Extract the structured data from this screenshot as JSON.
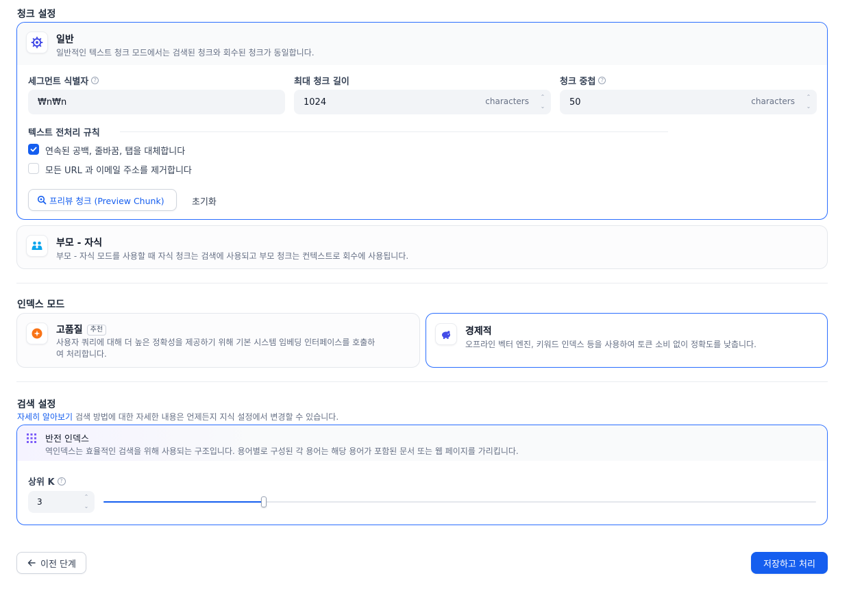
{
  "chunk_settings": {
    "title": "청크 설정",
    "general": {
      "icon": "gear-icon",
      "title": "일반",
      "desc": "일반적인 텍스트 청크 모드에서는 검색된 청크와 회수된 청크가 동일합니다.",
      "segment_label": "세그먼트 식별자",
      "segment_value": "₩n₩n",
      "max_length_label": "최대 청크 길이",
      "max_length_value": "1024",
      "overlap_label": "청크 중첩",
      "overlap_value": "50",
      "unit": "characters",
      "preprocess_label": "텍스트 전처리 규칙",
      "rule1": "연속된 공백, 줄바꿈, 탭을 대체합니다",
      "rule1_checked": true,
      "rule2": "모든 URL 과 이메일 주소를 제거합니다",
      "rule2_checked": false,
      "preview_button": "프리뷰 청크 (Preview Chunk)",
      "reset_button": "초기화"
    },
    "parent_child": {
      "icon": "parent-child-icon",
      "title": "부모 - 자식",
      "desc": "부모 - 자식 모드를 사용할 때 자식 청크는 검색에 사용되고 부모 청크는 컨텍스트로 회수에 사용됩니다."
    }
  },
  "index_mode": {
    "title": "인덱스 모드",
    "high_quality": {
      "icon": "sparkle-icon",
      "title": "고품질",
      "badge": "추천",
      "desc_line1": "사용자 쿼리에 대해 더 높은 정확성을 제공하기 위해 기본 시스템 임베딩 인터페이스를 호출하",
      "desc_line2": "여 처리합니다."
    },
    "economy": {
      "icon": "piggy-bank-icon",
      "title": "경제적",
      "desc": "오프라인 벡터 엔진, 키워드 인덱스 등을 사용하여 토큰 소비 없이 정확도를 낮춥니다."
    }
  },
  "retrieval": {
    "title": "검색 설정",
    "learn_more": "자세히 알아보기",
    "subtitle": "검색 방법에 대한 자세한 내용은 언제든지 지식 설정에서 변경할 수 있습니다.",
    "inverted": {
      "icon": "grid-icon",
      "title": "반전 인덱스",
      "desc": "역인덱스는 효율적인 검색을 위해 사용되는 구조입니다. 용어별로 구성된 각 용어는 해당 용어가 포함된 문서 또는 웹 페이지를 가리킵니다.",
      "topk_label": "상위 K",
      "topk_value": "3",
      "slider_fraction": 0.225
    }
  },
  "footer": {
    "prev_button": "이전 단계",
    "save_button": "저장하고 처리"
  },
  "colors": {
    "accent": "#155eef",
    "active_border": "#296dff"
  }
}
